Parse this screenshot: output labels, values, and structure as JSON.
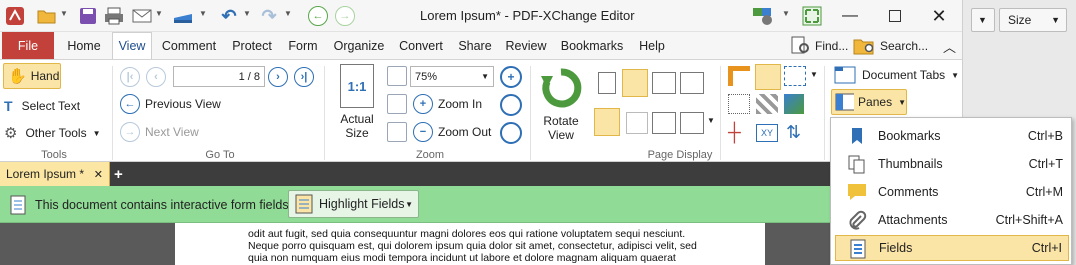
{
  "window": {
    "title": "Lorem Ipsum* - PDF-XChange Editor"
  },
  "right_strip": {
    "size_label": "Size"
  },
  "menu_tabs": [
    "File",
    "Home",
    "View",
    "Comment",
    "Protect",
    "Form",
    "Organize",
    "Convert",
    "Share",
    "Review",
    "Bookmarks",
    "Help"
  ],
  "menu_right": {
    "find": "Find...",
    "search": "Search..."
  },
  "tools": {
    "hand": "Hand",
    "select_text": "Select Text",
    "other_tools": "Other Tools",
    "group": "Tools"
  },
  "goto": {
    "prev": "Previous View",
    "next": "Next View",
    "page_value": "1 / 8",
    "group": "Go To"
  },
  "zoom": {
    "actual_size_1": "Actual",
    "actual_size_2": "Size",
    "value": "75%",
    "zoom_in": "Zoom In",
    "zoom_out": "Zoom Out",
    "group": "Zoom",
    "one_to_one": "1:1"
  },
  "page_display": {
    "rotate_1": "Rotate",
    "rotate_2": "View",
    "group": "Page Display"
  },
  "panes_group": {
    "document_tabs": "Document Tabs",
    "panes": "Panes"
  },
  "doc_tab": {
    "label": "Lorem Ipsum *"
  },
  "formbar": {
    "message": "This document contains interactive form fields.",
    "highlight": "Highlight Fields"
  },
  "doc_text": [
    "odit aut fugit, sed quia consequuntur magni dolores eos qui ratione voluptatem sequi nesciunt.",
    "Neque porro quisquam est, qui dolorem ipsum quia dolor sit amet, consectetur, adipisci velit, sed",
    "quia non numquam eius modi tempora incidunt ut labore et dolore magnam aliquam quaerat"
  ],
  "panes_menu": [
    {
      "label": "Bookmarks",
      "shortcut": "Ctrl+B",
      "icon": "bookmarks-icon"
    },
    {
      "label": "Thumbnails",
      "shortcut": "Ctrl+T",
      "icon": "thumbnails-icon"
    },
    {
      "label": "Comments",
      "shortcut": "Ctrl+M",
      "icon": "comments-icon"
    },
    {
      "label": "Attachments",
      "shortcut": "Ctrl+Shift+A",
      "icon": "attachments-icon"
    },
    {
      "label": "Fields",
      "shortcut": "Ctrl+I",
      "icon": "fields-icon"
    }
  ],
  "colors": {
    "file_tab": "#c3413b",
    "accent_blue": "#2e6fb5",
    "highlight": "#fbe5a6",
    "formbar": "#90dc96"
  }
}
